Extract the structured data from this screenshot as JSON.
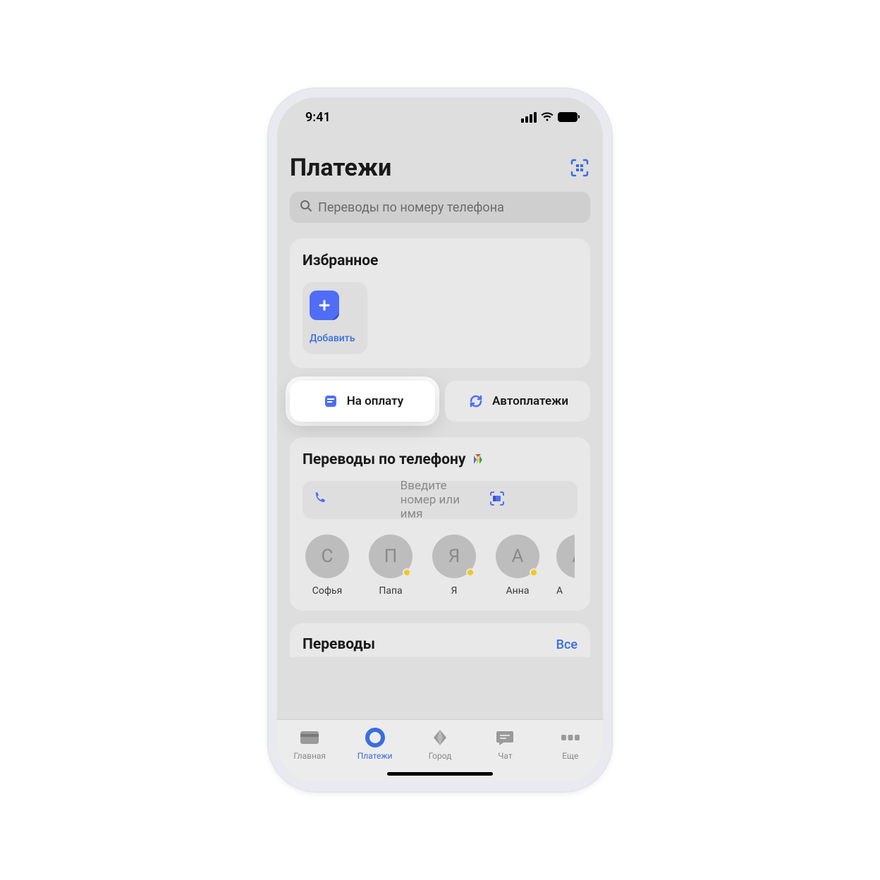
{
  "status": {
    "time": "9:41"
  },
  "header": {
    "title": "Платежи"
  },
  "search": {
    "placeholder": "Переводы по номеру телефона"
  },
  "favorites": {
    "title": "Избранное",
    "add_label": "Добавить"
  },
  "chips": {
    "pay": "На оплату",
    "auto": "Автоплатежи"
  },
  "phone_transfers": {
    "title": "Переводы по телефону",
    "input_placeholder": "Введите номер или имя",
    "contacts": [
      {
        "initial": "С",
        "name": "Софья",
        "dot": false
      },
      {
        "initial": "П",
        "name": "Папа",
        "dot": true
      },
      {
        "initial": "Я",
        "name": "Я",
        "dot": true
      },
      {
        "initial": "А",
        "name": "Анна",
        "dot": true
      },
      {
        "initial": "А",
        "name": "А",
        "dot": false
      }
    ]
  },
  "transfers2": {
    "title": "Переводы",
    "all": "Все"
  },
  "tabs": {
    "home": "Главная",
    "payments": "Платежи",
    "city": "Город",
    "chat": "Чат",
    "more": "Еще"
  }
}
